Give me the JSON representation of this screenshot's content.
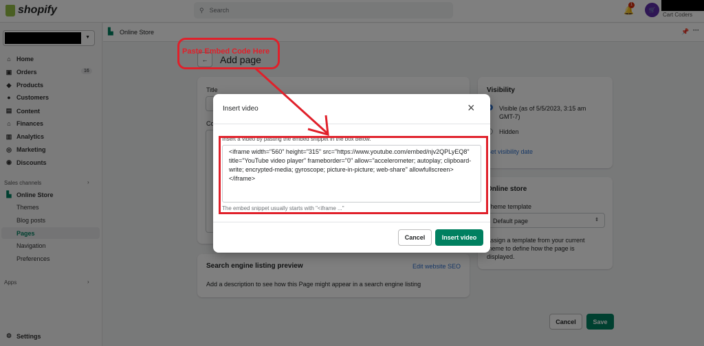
{
  "topbar": {
    "logo": "shopify",
    "search_placeholder": "Search",
    "notification_count": "1",
    "store_name": "Cart Coders"
  },
  "sidebar": {
    "items": [
      {
        "label": "Home",
        "icon": "⌂"
      },
      {
        "label": "Orders",
        "icon": "▣",
        "badge": "16"
      },
      {
        "label": "Products",
        "icon": "◆"
      },
      {
        "label": "Customers",
        "icon": "●"
      },
      {
        "label": "Content",
        "icon": "▤"
      },
      {
        "label": "Finances",
        "icon": "⌂"
      },
      {
        "label": "Analytics",
        "icon": "▥"
      },
      {
        "label": "Marketing",
        "icon": "◎"
      },
      {
        "label": "Discounts",
        "icon": "◉"
      }
    ],
    "sales_channels": "Sales channels",
    "online_store": "Online Store",
    "sub_items": [
      "Themes",
      "Blog posts",
      "Pages",
      "Navigation",
      "Preferences"
    ],
    "active_sub": "Pages",
    "apps": "Apps",
    "settings": "Settings"
  },
  "breadcrumb": {
    "label": "Online Store"
  },
  "page": {
    "title": "Add page",
    "title_label": "Title",
    "content_label": "Content",
    "seo": {
      "title": "Search engine listing preview",
      "link": "Edit website SEO",
      "description": "Add a description to see how this Page might appear in a search engine listing"
    },
    "visibility": {
      "title": "Visibility",
      "visible": "Visible (as of 5/5/2023, 3:15 am GMT-7)",
      "hidden": "Hidden",
      "set_date": "Set visibility date",
      "selected": "visible"
    },
    "online_store": {
      "title": "Online store",
      "template_label": "Theme template",
      "template_value": "Default page",
      "help": "Assign a template from your current theme to define how the page is displayed."
    },
    "cancel": "Cancel",
    "save": "Save"
  },
  "modal": {
    "title": "Insert video",
    "instruction": "Insert a video by pasting the embed snippet in the box below.",
    "snippet": "<iframe width=\"560\" height=\"315\" src=\"https://www.youtube.com/embed/njv2QPLyEQ8\" title=\"YouTube video player\" frameborder=\"0\" allow=\"accelerometer; autoplay; clipboard-write; encrypted-media; gyroscope; picture-in-picture; web-share\" allowfullscreen></iframe>",
    "hint": "The embed snippet usually starts with \"<iframe ...\"",
    "cancel": "Cancel",
    "insert": "Insert video"
  },
  "annotation": {
    "text": "Paste Embed Code Here",
    "color": "#e0202a"
  },
  "colors": {
    "primary": "#008060",
    "annotation": "#e0202a"
  }
}
